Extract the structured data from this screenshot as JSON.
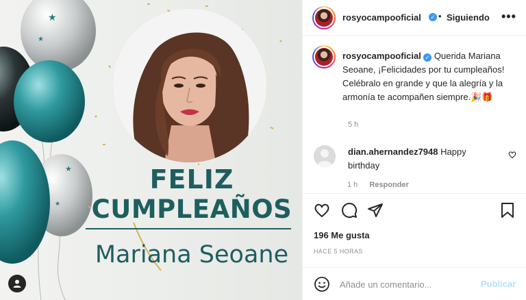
{
  "post": {
    "headline": "FELIZ",
    "headline_2": "CUMPLEAÑOS",
    "honoree": "Mariana Seoane"
  },
  "header": {
    "username": "rosyocampooficial",
    "separator": "•",
    "follow_state": "Siguiendo",
    "more": "•••"
  },
  "caption": {
    "username": "rosyocampooficial",
    "text": "Querida Mariana Seoane, ¡Felicidades por tu cumpleaños! Celébralo en grande y que la alegría y la armonía te acompañen siempre.",
    "emoji": "🎉🎁",
    "time": "5 h"
  },
  "comment": {
    "username": "dian.ahernandez7948",
    "text": "Happy birthday",
    "time": "1 h",
    "reply_label": "Responder"
  },
  "likes": "196 Me gusta",
  "posted": "HACE 5 HORAS",
  "add_comment": {
    "placeholder": "Añade un comentario...",
    "publish_label": "Publicar"
  },
  "colors": {
    "brand_teal": "#1f5e5f",
    "verified_blue": "#3897f0",
    "publish_disabled": "#b2dffc"
  }
}
